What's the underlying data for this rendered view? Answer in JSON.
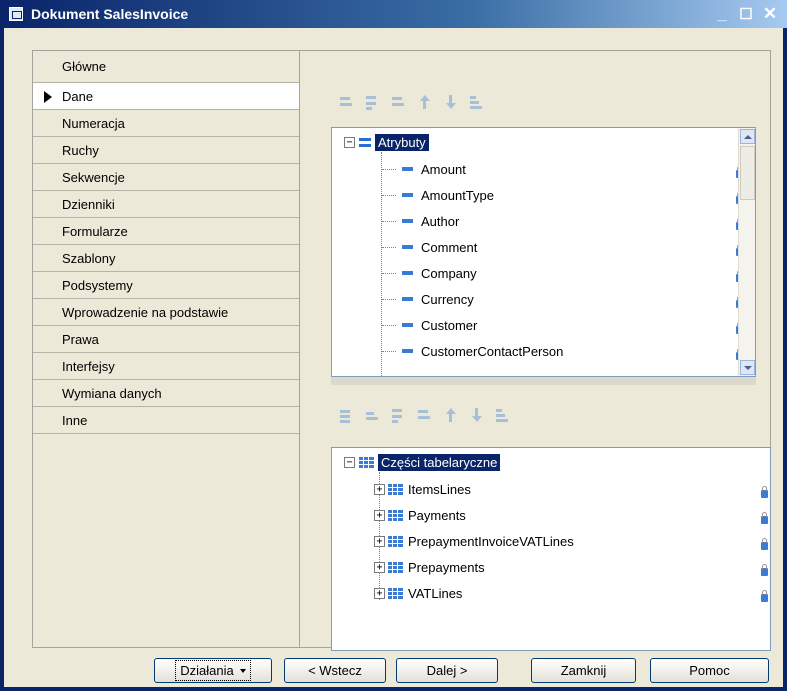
{
  "window": {
    "title": "Dokument SalesInvoice",
    "minimize": "_",
    "maximize": "☐",
    "close": "✕"
  },
  "tabs": [
    {
      "label": "Główne"
    },
    {
      "label": "Dane"
    },
    {
      "label": "Numeracja"
    },
    {
      "label": "Ruchy"
    },
    {
      "label": "Sekwencje"
    },
    {
      "label": "Dzienniki"
    },
    {
      "label": "Formularze"
    },
    {
      "label": "Szablony"
    },
    {
      "label": "Podsystemy"
    },
    {
      "label": "Wprowadzenie na podstawie"
    },
    {
      "label": "Prawa"
    },
    {
      "label": "Interfejsy"
    },
    {
      "label": "Wymiana danych"
    },
    {
      "label": "Inne"
    }
  ],
  "active_tab": "Dane",
  "attributes_tree": {
    "root": "Atrybuty",
    "expander": "−",
    "items": [
      "Amount",
      "AmountType",
      "Author",
      "Comment",
      "Company",
      "Currency",
      "Customer",
      "CustomerContactPerson"
    ]
  },
  "tabular_tree": {
    "root": "Części tabelaryczne",
    "expander": "−",
    "child_expander": "+",
    "items": [
      "ItemsLines",
      "Payments",
      "PrepaymentInvoiceVATLines",
      "Prepayments",
      "VATLines"
    ]
  },
  "buttons": {
    "actions": "Działania",
    "back": "< Wstecz",
    "next": "Dalej >",
    "close": "Zamknij",
    "help": "Pomoc"
  },
  "colors": {
    "title_bar": "#0a246a",
    "selection": "#0a246a",
    "face": "#ece9d8",
    "icon": "#3a7bd5"
  }
}
